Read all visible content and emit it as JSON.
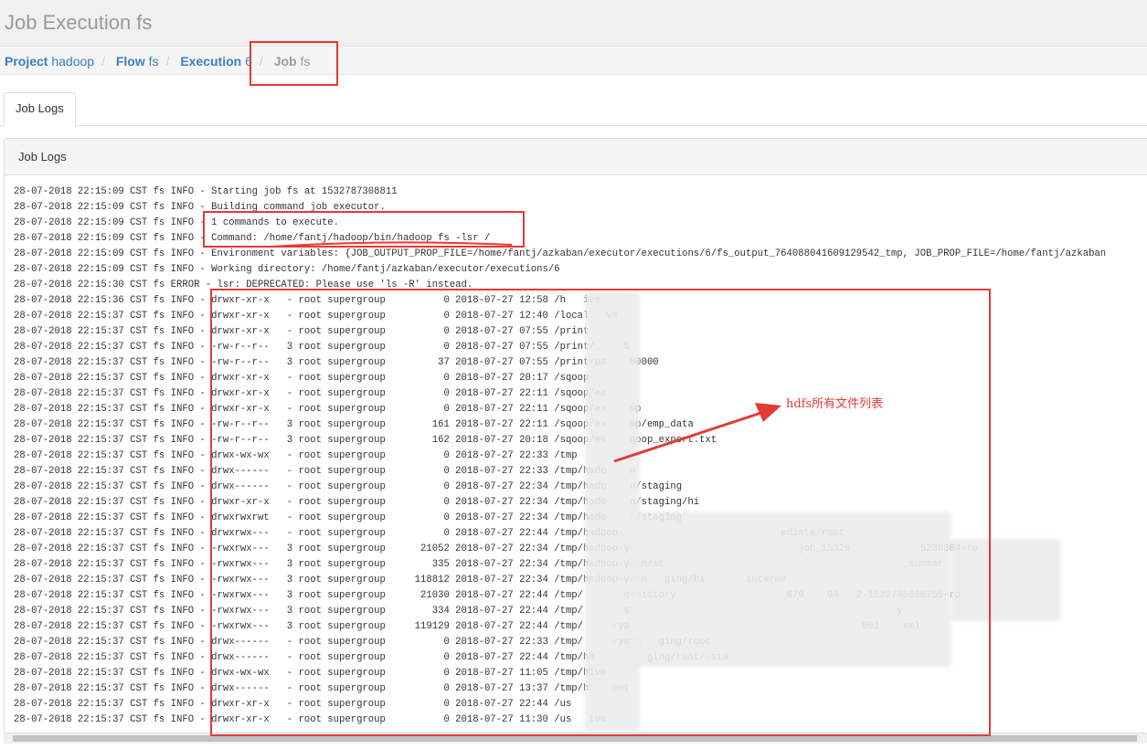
{
  "header": {
    "title": "Job Execution fs"
  },
  "breadcrumb": [
    {
      "label": "Project",
      "value": "hadoop"
    },
    {
      "label": "Flow",
      "value": "fs"
    },
    {
      "label": "Execution",
      "value": "6"
    },
    {
      "label": "Job",
      "value": "fs"
    }
  ],
  "tabs": [
    {
      "label": "Job Logs"
    }
  ],
  "panel": {
    "title": "Job Logs"
  },
  "log": {
    "lines": [
      "28-07-2018 22:15:09 CST fs INFO - Starting job fs at 1532787308811",
      "28-07-2018 22:15:09 CST fs INFO - Building command job executor.",
      "28-07-2018 22:15:09 CST fs INFO - 1 commands to execute.",
      "28-07-2018 22:15:09 CST fs INFO - Command: /home/fantj/hadoop/bin/hadoop fs -lsr /",
      "28-07-2018 22:15:09 CST fs INFO - Environment variables: {JOB_OUTPUT_PROP_FILE=/home/fantj/azkaban/executor/executions/6/fs_output_764088041609129542_tmp, JOB_PROP_FILE=/home/fantj/azkaban",
      "28-07-2018 22:15:09 CST fs INFO - Working directory: /home/fantj/azkaban/executor/executions/6",
      "28-07-2018 22:15:30 CST fs ERROR - lsr: DEPRECATED: Please use 'ls -R' instead.",
      "28-07-2018 22:15:36 CST fs INFO - drwxr-xr-x   - root supergroup          0 2018-07-27 12:58 /h   ive",
      "28-07-2018 22:15:37 CST fs INFO - drwxr-xr-x   - root supergroup          0 2018-07-27 12:40 /local.  ve",
      "28-07-2018 22:15:37 CST fs INFO - drwxr-xr-x   - root supergroup          0 2018-07-27 07:55 /print",
      "28-07-2018 22:15:37 CST fs INFO - -rw-r--r--   3 root supergroup          0 2018-07-27 07:55 /print/_    S",
      "28-07-2018 22:15:37 CST fs INFO - -rw-r--r--   3 root supergroup         37 2018-07-27 07:55 /print/pa    00000",
      "28-07-2018 22:15:37 CST fs INFO - drwxr-xr-x   - root supergroup          0 2018-07-27 20:17 /sqoop",
      "28-07-2018 22:15:37 CST fs INFO - drwxr-xr-x   - root supergroup          0 2018-07-27 22:11 /sqoop/ex",
      "28-07-2018 22:15:37 CST fs INFO - drwxr-xr-x   - root supergroup          0 2018-07-27 22:11 /sqoop/ex    mp",
      "28-07-2018 22:15:37 CST fs INFO - -rw-r--r--   3 root supergroup        161 2018-07-27 22:11 /sqoop/ex    mp/emp_data",
      "28-07-2018 22:15:37 CST fs INFO - -rw-r--r--   3 root supergroup        162 2018-07-27 20:18 /sqoop/ex    qoop_export.txt",
      "28-07-2018 22:15:37 CST fs INFO - drwx-wx-wx   - root supergroup          0 2018-07-27 22:33 /tmp",
      "28-07-2018 22:15:37 CST fs INFO - drwx------   - root supergroup          0 2018-07-27 22:33 /tmp/hado    n",
      "28-07-2018 22:15:37 CST fs INFO - drwx------   - root supergroup          0 2018-07-27 22:34 /tmp/hado    n/staging",
      "28-07-2018 22:15:37 CST fs INFO - drwxr-xr-x   - root supergroup          0 2018-07-27 22:34 /tmp/hado    n/staging/hi",
      "28-07-2018 22:15:37 CST fs INFO - drwxrwxrwt   - root supergroup          0 2018-07-27 22:34 /tmp/hado    n/staging",
      "28-07-2018 22:15:37 CST fs INFO - drwxrwx---   - root supergroup          0 2018-07-27 22:44 /tmp/hadoop-                           ediate/root",
      "28-07-2018 22:15:37 CST fs INFO - -rwxrwx---   3 root supergroup      21052 2018-07-27 22:34 /tmp/hadoop-y                             job_15326            5238804-ro",
      "28-07-2018 22:15:37 CST fs INFO - -rwxrwx---   3 root supergroup        335 2018-07-27 22:34 /tmp/hadoop-yarn/st                                          summar",
      "28-07-2018 22:15:37 CST fs INFO - -rwxrwx---   3 root supergroup     118812 2018-07-27 22:34 /tmp/hadoop-yarn   ging/hi       interme",
      "28-07-2018 22:15:37 CST fs INFO - -rwxrwx---   3 root supergroup      21030 2018-07-27 22:44 /tmp/       g/history                   679    94   2-1532745866755-ro",
      "28-07-2018 22:15:37 CST fs INFO - -rwxrwx---   3 root supergroup        334 2018-07-27 22:44 /tmp/       st                                             y",
      "28-07-2018 22:15:37 CST fs INFO - -rwxrwx---   3 root supergroup     119129 2018-07-27 22:44 /tmp/     -ya                                        001    xml",
      "28-07-2018 22:15:37 CST fs INFO - drwx------   - root supergroup          0 2018-07-27 22:33 /tmp/     -yarn   ging/root",
      "28-07-2018 22:15:37 CST fs INFO - drwx------   - root supergroup          0 2018-07-27 22:44 /tmp/ha         ging/root/.sta",
      "28-07-2018 22:15:37 CST fs INFO - drwx-wx-wx   - root supergroup          0 2018-07-27 11:05 /tmp/hive",
      "28-07-2018 22:15:37 CST fs INFO - drwx------   - root supergroup          0 2018-07-27 13:37 /tmp/h    oot",
      "28-07-2018 22:15:37 CST fs INFO - drwxr-xr-x   - root supergroup          0 2018-07-27 22:44 /us",
      "28-07-2018 22:15:37 CST fs INFO - drwxr-xr-x   - root supergroup          0 2018-07-27 11:30 /us   ive"
    ]
  },
  "annotation": {
    "text": "hdfs所有文件列表",
    "color": "#e53935"
  }
}
